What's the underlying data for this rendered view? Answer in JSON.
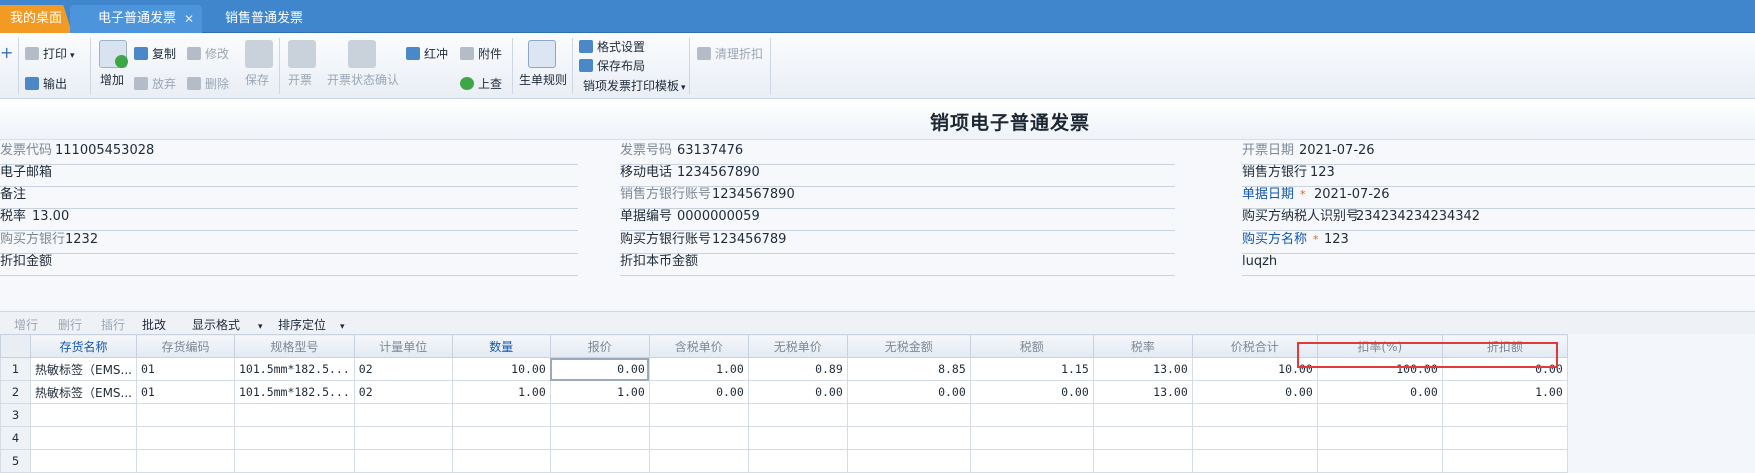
{
  "tabs": [
    {
      "label": "我的桌面"
    },
    {
      "label": "电子普通发票"
    },
    {
      "label": "销售普通发票"
    }
  ],
  "toolbar": {
    "print": "打印",
    "export": "输出",
    "add": "增加",
    "copy": "复制",
    "edit": "修改",
    "save": "保存",
    "discard": "放弃",
    "delete": "删除",
    "invoice": "开票",
    "invoice_status": "开票状态确认",
    "red_offset": "红冲",
    "attachment": "附件",
    "lookup": "上查",
    "gen_rule": "生单规则",
    "format_settings": "格式设置",
    "save_layout": "保存布局",
    "print_template": "销项发票打印模板",
    "clear_discount": "清理折扣"
  },
  "document": {
    "title": "销项电子普通发票"
  },
  "form": {
    "invoice_code": {
      "label": "发票代码",
      "value": "111005453028"
    },
    "email": {
      "label": "电子邮箱",
      "value": ""
    },
    "remark": {
      "label": "备注",
      "value": ""
    },
    "tax_rate": {
      "label": "税率",
      "value": "13.00"
    },
    "buyer_bank": {
      "label": "购买方银行",
      "value": "1232"
    },
    "discount_amount": {
      "label": "折扣金额",
      "value": ""
    },
    "invoice_no": {
      "label": "发票号码",
      "value": "63137476"
    },
    "mobile": {
      "label": "移动电话",
      "value": "1234567890"
    },
    "seller_bank_account": {
      "label": "销售方银行账号",
      "value": "1234567890"
    },
    "doc_no": {
      "label": "单据编号",
      "value": "0000000059"
    },
    "buyer_bank_account": {
      "label": "购买方银行账号",
      "value": "123456789"
    },
    "discount_local": {
      "label": "折扣本币金额",
      "value": ""
    },
    "issue_date": {
      "label": "开票日期",
      "value": "2021-07-26"
    },
    "seller_bank": {
      "label": "销售方银行",
      "value": "123"
    },
    "doc_date": {
      "label": "单据日期",
      "value": "2021-07-26"
    },
    "buyer_tax_id": {
      "label": "购买方纳税人识别号",
      "value": "234234234234342"
    },
    "buyer_name": {
      "label": "购买方名称",
      "value": "123"
    },
    "operator": {
      "value": "luqzh"
    }
  },
  "grid_toolbar": {
    "add_row": "增行",
    "del_row": "删行",
    "insert_row": "插行",
    "batch_edit": "批改",
    "display_format": "显示格式",
    "sort_locate": "排序定位"
  },
  "table": {
    "columns": [
      "存货名称",
      "存货编码",
      "规格型号",
      "计量单位",
      "数量",
      "报价",
      "含税单价",
      "无税单价",
      "无税金额",
      "税额",
      "税率",
      "价税合计",
      "扣率(%)",
      "折扣额"
    ],
    "rows": [
      {
        "n": "1",
        "cells": [
          "热敏标签（EMS...",
          "01",
          "101.5mm*182.5...",
          "02",
          "10.00",
          "0.00",
          "1.00",
          "0.89",
          "8.85",
          "1.15",
          "13.00",
          "10.00",
          "100.00",
          "0.00"
        ]
      },
      {
        "n": "2",
        "cells": [
          "热敏标签（EMS...",
          "01",
          "101.5mm*182.5...",
          "02",
          "1.00",
          "1.00",
          "0.00",
          "0.00",
          "0.00",
          "0.00",
          "13.00",
          "0.00",
          "0.00",
          "1.00"
        ]
      },
      {
        "n": "3",
        "cells": [
          "",
          "",
          "",
          "",
          "",
          "",
          "",
          "",
          "",
          "",
          "",
          "",
          "",
          ""
        ]
      },
      {
        "n": "4",
        "cells": [
          "",
          "",
          "",
          "",
          "",
          "",
          "",
          "",
          "",
          "",
          "",
          "",
          "",
          ""
        ]
      },
      {
        "n": "5",
        "cells": [
          "",
          "",
          "",
          "",
          "",
          "",
          "",
          "",
          "",
          "",
          "",
          "",
          "",
          ""
        ]
      }
    ]
  },
  "colors": {
    "tab_bar": "#3f86cc",
    "desktop_tab": "#f39a23",
    "highlight_box": "#e23a3a",
    "key_label": "#1558b0"
  }
}
